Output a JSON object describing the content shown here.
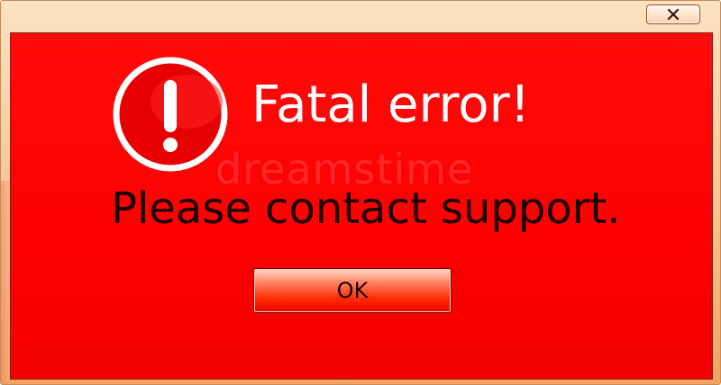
{
  "window": {
    "close_glyph": "x",
    "close_icon": "close-icon"
  },
  "dialog": {
    "icon": "exclamation-alert-icon",
    "title": "Fatal error!",
    "message": "Please contact support.",
    "ok_label": "OK",
    "watermark": "dreamstime"
  },
  "colors": {
    "background": "#ff0000",
    "frame": "#f7c48f",
    "title_text": "#ffffff",
    "message_text": "#1a0000"
  }
}
